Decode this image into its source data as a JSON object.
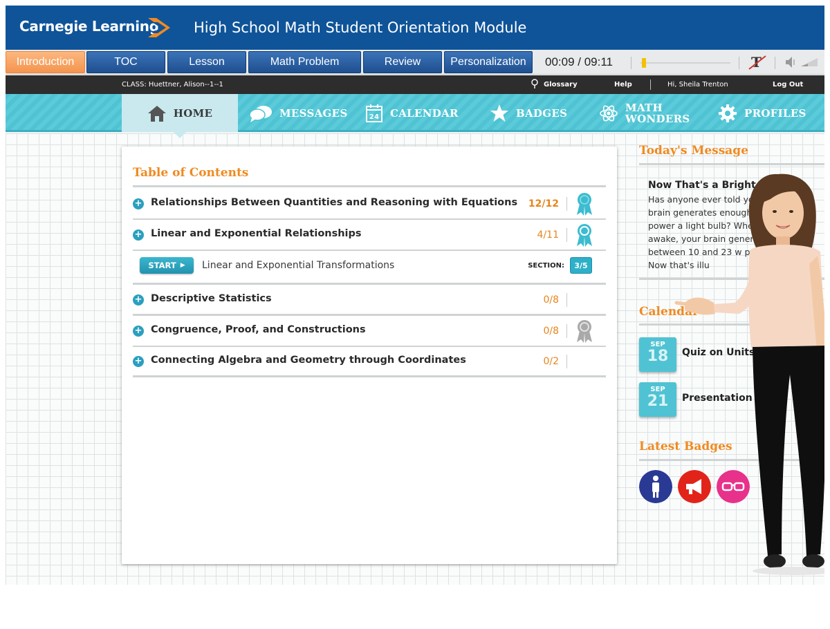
{
  "header": {
    "logo_text": "Carnegie Learning",
    "module_title": "High School Math Student Orientation Module"
  },
  "toolbar": {
    "tabs": [
      {
        "label": "Introduction",
        "active": true
      },
      {
        "label": "TOC",
        "active": false
      },
      {
        "label": "Lesson",
        "active": false
      },
      {
        "label": "Math Problem",
        "active": false
      },
      {
        "label": "Review",
        "active": false
      },
      {
        "label": "Personalization",
        "active": false
      }
    ],
    "timecode": "00:09 / 09:11",
    "progress_fraction": 0.016
  },
  "topbar": {
    "class_label": "CLASS: Huettner, Alison--1--1",
    "glossary": "Glossary",
    "help": "Help",
    "greeting": "Hi, Sheila Trenton",
    "logout": "Log Out"
  },
  "nav": {
    "items": [
      {
        "label": "HOME",
        "icon": "house-icon",
        "active": true
      },
      {
        "label": "MESSAGES",
        "icon": "speech-bubbles-icon",
        "active": false
      },
      {
        "label": "CALENDAR",
        "icon": "calendar-icon",
        "active": false
      },
      {
        "label": "BADGES",
        "icon": "star-icon",
        "active": false
      },
      {
        "label": "MATH",
        "label2": "WONDERS",
        "icon": "atom-icon",
        "active": false
      },
      {
        "label": "PROFILES",
        "icon": "gear-icon",
        "active": false
      }
    ],
    "calendar_icon_day": "24"
  },
  "toc": {
    "title": "Table of Contents",
    "units": [
      {
        "title": "Relationships Between Quantities and Reasoning with Equations",
        "progress": "12/12",
        "ribbon": "teal"
      },
      {
        "title": "Linear and Exponential Relationships",
        "progress": "4/11",
        "ribbon": "teal"
      },
      {
        "title": "Descriptive Statistics",
        "progress": "0/8",
        "ribbon": "none"
      },
      {
        "title": "Congruence, Proof, and Constructions",
        "progress": "0/8",
        "ribbon": "gray"
      },
      {
        "title": "Connecting Algebra and Geometry through Coordinates",
        "progress": "0/2",
        "ribbon": "none"
      }
    ],
    "current": {
      "button": "START",
      "title": "Linear and Exponential Transformations",
      "section_label": "SECTION:",
      "section_value": "3/5"
    }
  },
  "sidebar": {
    "message_heading": "Today's Message",
    "message_title": "Now That's a Bright Id",
    "message_body": "Has anyone ever told you y brain generates enough en power a light bulb? When y awake, your brain genera between 10 and 23 w power. Now that's illu",
    "calendar_heading": "Calendar",
    "events": [
      {
        "month": "SEP",
        "day": "18",
        "text": "Quiz on Units"
      },
      {
        "month": "SEP",
        "day": "21",
        "text": "Presentation P"
      }
    ],
    "badges_heading": "Latest Badges",
    "badges": [
      {
        "icon": "person-icon",
        "color": "#2a3a94"
      },
      {
        "icon": "megaphone-icon",
        "color": "#e2231a"
      },
      {
        "icon": "glasses-icon",
        "color": "#e8318a"
      }
    ]
  },
  "colors": {
    "header_blue": "#0f5499",
    "accent_orange": "#f08a21",
    "nav_teal": "#4fc3d3"
  }
}
